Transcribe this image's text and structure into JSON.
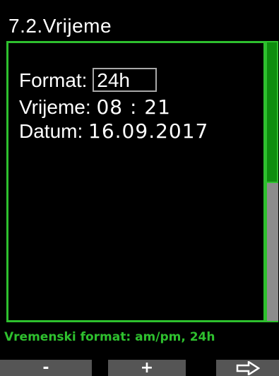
{
  "title": "7.2.Vrijeme",
  "settings": {
    "format_label": "Format:",
    "format_value": "24h",
    "time_label": "Vrijeme:",
    "time_value": "08 : 21",
    "date_label": "Datum:",
    "date_value": "16.09.2017"
  },
  "hint": "Vremenski format: am/pm, 24h",
  "softkeys": {
    "left_label": "-",
    "middle_label": "+",
    "right_icon": "arrow-right-icon"
  },
  "colors": {
    "accent": "#2ec02e",
    "scroll_thumb": "#0e8d0e",
    "scroll_track": "#8c8c8c",
    "softkey_bg": "#555555",
    "background": "#000000"
  }
}
